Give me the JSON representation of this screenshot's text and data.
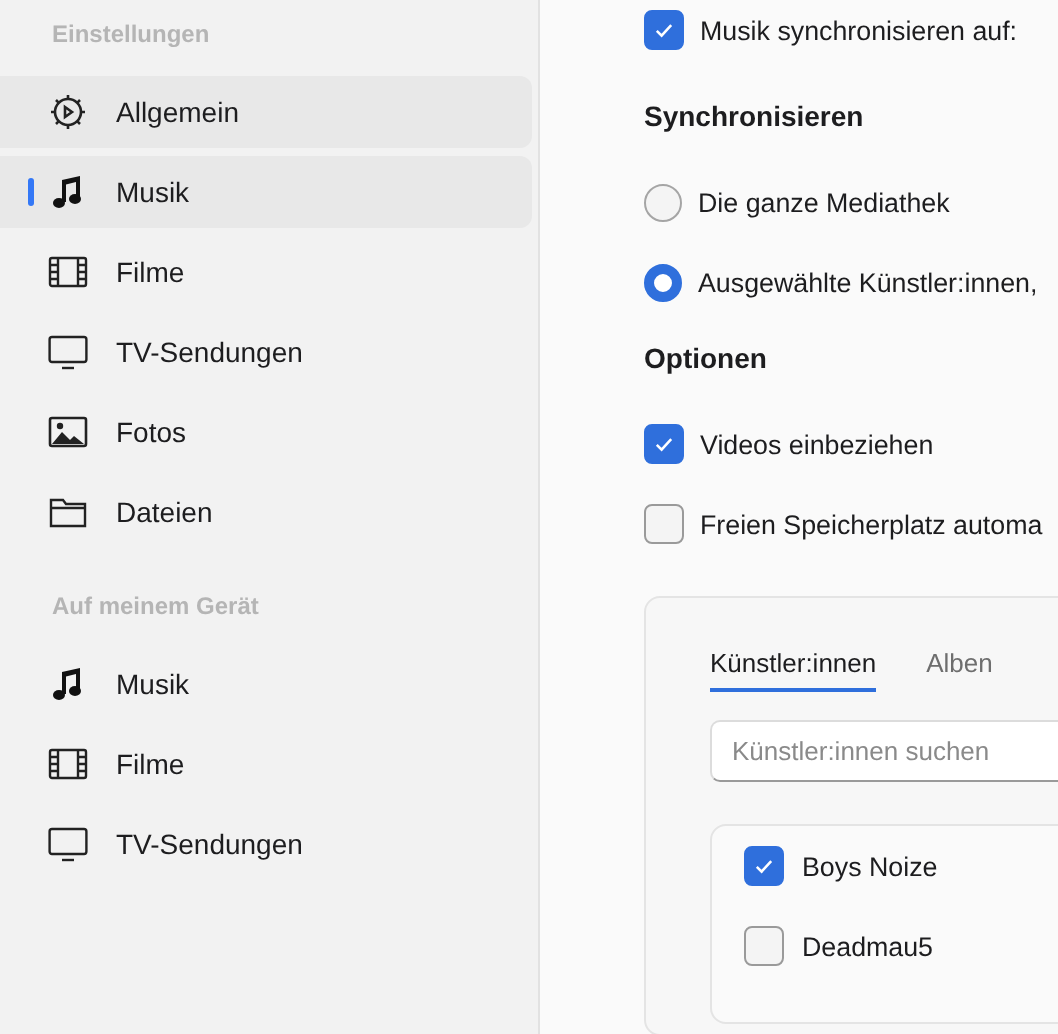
{
  "sidebar": {
    "sections": [
      {
        "title": "Einstellungen",
        "items": [
          {
            "label": "Allgemein",
            "kind": "gear",
            "selected": false,
            "hovered": true
          },
          {
            "label": "Musik",
            "kind": "note",
            "selected": true,
            "hovered": false
          },
          {
            "label": "Filme",
            "kind": "film",
            "selected": false,
            "hovered": false
          },
          {
            "label": "TV-Sendungen",
            "kind": "tv",
            "selected": false,
            "hovered": false
          },
          {
            "label": "Fotos",
            "kind": "photo",
            "selected": false,
            "hovered": false
          },
          {
            "label": "Dateien",
            "kind": "folder",
            "selected": false,
            "hovered": false
          }
        ]
      },
      {
        "title": "Auf meinem Gerät",
        "items": [
          {
            "label": "Musik",
            "kind": "note",
            "selected": false,
            "hovered": false
          },
          {
            "label": "Filme",
            "kind": "film",
            "selected": false,
            "hovered": false
          },
          {
            "label": "TV-Sendungen",
            "kind": "tv",
            "selected": false,
            "hovered": false
          }
        ]
      }
    ]
  },
  "main": {
    "sync_checkbox": {
      "label": "Musik synchronisieren auf:",
      "checked": true
    },
    "sync_heading": "Synchronisieren",
    "sync_options": [
      {
        "label": "Die ganze Mediathek",
        "selected": false
      },
      {
        "label": "Ausgewählte Künstler:innen,",
        "selected": true
      }
    ],
    "options_heading": "Optionen",
    "options": [
      {
        "label": "Videos einbeziehen",
        "checked": true
      },
      {
        "label": "Freien Speicherplatz automa",
        "checked": false
      }
    ],
    "panel": {
      "tabs": [
        {
          "label": "Künstler:innen",
          "selected": true
        },
        {
          "label": "Alben",
          "selected": false
        }
      ],
      "search": {
        "placeholder": "Künstler:innen suchen"
      },
      "artists": [
        {
          "name": "Boys Noize",
          "checked": true
        },
        {
          "name": "Deadmau5",
          "checked": false
        }
      ]
    }
  }
}
